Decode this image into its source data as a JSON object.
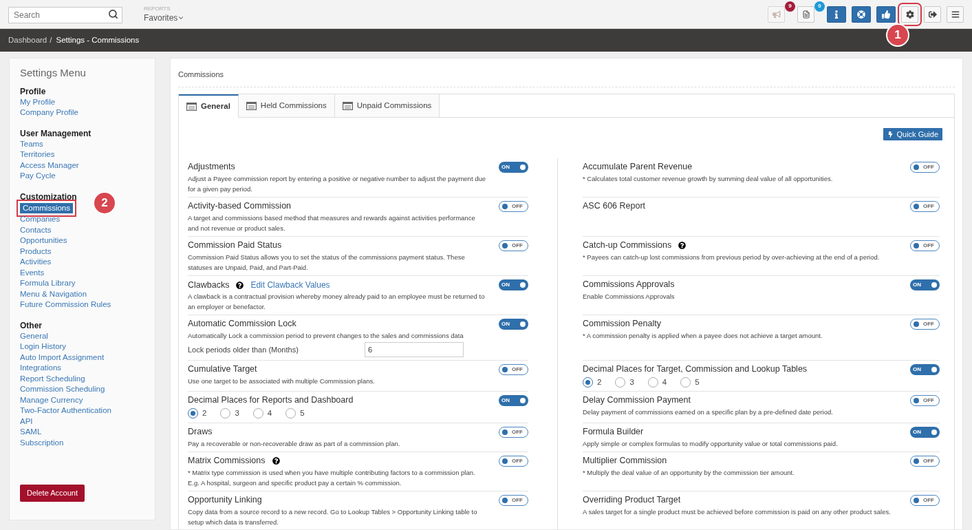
{
  "topbar": {
    "search": {
      "placeholder": "Search"
    },
    "reports": {
      "label": "REPORTS",
      "value": "Favorites"
    },
    "buttons": [
      {
        "kind": "megaphone",
        "badge": "9",
        "color": "#a51d3a"
      },
      {
        "kind": "document",
        "badge": "0",
        "color": "#1e9ad6"
      },
      {
        "kind": "info"
      },
      {
        "kind": "lifebuoy"
      },
      {
        "kind": "thumbsup"
      },
      {
        "kind": "gear",
        "callout": "1"
      },
      {
        "kind": "logout"
      },
      {
        "kind": "menu"
      }
    ]
  },
  "breadcrumb": {
    "items": [
      "Dashboard",
      "Settings - Commissions"
    ],
    "separator": "/"
  },
  "sidebar": {
    "title": "Settings Menu",
    "sections": [
      {
        "heading": "Profile",
        "items": [
          {
            "label": "My Profile",
            "selected": false
          },
          {
            "label": "Company Profile",
            "selected": false
          }
        ]
      },
      {
        "heading": "User Management",
        "items": [
          {
            "label": "Teams",
            "selected": false
          },
          {
            "label": "Territories",
            "selected": false
          },
          {
            "label": "Access Manager",
            "selected": false
          },
          {
            "label": "Pay Cycle",
            "selected": false
          }
        ]
      },
      {
        "heading": "Customization",
        "items": [
          {
            "label": "Commissions",
            "selected": true,
            "callout": "2"
          },
          {
            "label": "Companies",
            "selected": false
          },
          {
            "label": "Contacts",
            "selected": false
          },
          {
            "label": "Opportunities",
            "selected": false
          },
          {
            "label": "Products",
            "selected": false
          },
          {
            "label": "Activities",
            "selected": false
          },
          {
            "label": "Events",
            "selected": false
          },
          {
            "label": "Formula Library",
            "selected": false
          },
          {
            "label": "Menu & Navigation",
            "selected": false
          },
          {
            "label": "Future Commission Rules",
            "selected": false
          }
        ]
      },
      {
        "heading": "Other",
        "items": [
          {
            "label": "General",
            "selected": false
          },
          {
            "label": "Login History",
            "selected": false
          },
          {
            "label": "Auto Import Assignment",
            "selected": false
          },
          {
            "label": "Integrations",
            "selected": false
          },
          {
            "label": "Report Scheduling",
            "selected": false
          },
          {
            "label": "Commission Scheduling",
            "selected": false
          },
          {
            "label": "Manage Currency",
            "selected": false
          },
          {
            "label": "Two-Factor Authentication",
            "selected": false
          },
          {
            "label": "API",
            "selected": false
          },
          {
            "label": "SAML",
            "selected": false
          },
          {
            "label": "Subscription",
            "selected": false
          }
        ]
      }
    ],
    "delete_button": "Delete Account"
  },
  "panel": {
    "title": "Commissions",
    "tabs": [
      {
        "label": "General",
        "selected": true
      },
      {
        "label": "Held Commissions",
        "selected": false
      },
      {
        "label": "Unpaid Commissions",
        "selected": false
      }
    ],
    "quick_guide": "Quick Guide",
    "left_settings": [
      {
        "kind": "toggle",
        "title": "Adjustments",
        "help": false,
        "on": true,
        "toggle_text": "ON",
        "description": "Adjust a Payee commission report by entering a positive or negative number to adjust the payment due for a given pay period."
      },
      {
        "kind": "toggle",
        "title": "Activity-based Commission",
        "help": false,
        "on": false,
        "toggle_text": "OFF",
        "description": "A target and commissions based method that measures and rewards against activities performance and not revenue or product sales."
      },
      {
        "kind": "toggle",
        "title": "Commission Paid Status",
        "help": false,
        "on": false,
        "toggle_text": "OFF",
        "description": "Commission Paid Status allows you to set the status of the commissions payment status. These statuses are Unpaid, Paid, and Part-Paid."
      },
      {
        "kind": "toggle",
        "title": "Clawbacks",
        "help": true,
        "link": "Edit Clawback Values",
        "on": true,
        "toggle_text": "ON",
        "description": "A clawback is a contractual provision whereby money already paid to an employee must be returned to an employer or benefactor."
      },
      {
        "kind": "input",
        "title": "Automatic Commission Lock",
        "help": false,
        "on": true,
        "toggle_text": "ON",
        "description": "Automatically Lock a commission period to prevent changes to the sales and commissions data",
        "field_label": "Lock periods older than (Months)",
        "field_value": "6"
      },
      {
        "kind": "toggle",
        "title": "Cumulative Target",
        "help": false,
        "on": false,
        "toggle_text": "OFF",
        "description": "Use one target to be associated with multiple Commission plans."
      },
      {
        "kind": "radio",
        "title": "Decimal Places for Reports and Dashboard",
        "help": false,
        "on": true,
        "toggle_text": "ON",
        "options": [
          {
            "label": "2",
            "selected": true
          },
          {
            "label": "3",
            "selected": false
          },
          {
            "label": "4",
            "selected": false
          },
          {
            "label": "5",
            "selected": false
          }
        ]
      },
      {
        "kind": "toggle",
        "title": "Draws",
        "help": false,
        "on": false,
        "toggle_text": "OFF",
        "description": "Pay a recoverable or non-recoverable draw as part of a commission plan."
      },
      {
        "kind": "toggle",
        "title": "Matrix Commissions",
        "help": true,
        "on": false,
        "toggle_text": "OFF",
        "description": "* Matrix type commission is used when you have multiple contributing factors to a commission plan. E.g. A hospital, surgeon and specific product pay a certain % commission."
      },
      {
        "kind": "toggle",
        "title": "Opportunity Linking",
        "help": false,
        "on": false,
        "toggle_text": "OFF",
        "description": "Copy data from a source record to a new record. Go to Lookup Tables > Opportunity Linking table to setup which data is transferred."
      }
    ],
    "right_settings": [
      {
        "kind": "toggle",
        "title": "Accumulate Parent Revenue",
        "help": false,
        "on": false,
        "toggle_text": "OFF",
        "description": "* Calculates total customer revenue growth by summing deal value of all opportunities."
      },
      {
        "kind": "toggle",
        "title": "ASC 606 Report",
        "help": false,
        "on": false,
        "toggle_text": "OFF"
      },
      {
        "kind": "toggle",
        "title": "Catch-up Commissions",
        "help": true,
        "on": false,
        "toggle_text": "OFF",
        "description": "* Payees can catch-up lost commissions from previous period by over-achieving at the end of a period."
      },
      {
        "kind": "toggle",
        "title": "Commissions Approvals",
        "help": false,
        "on": true,
        "toggle_text": "ON",
        "description": "Enable Commissions Approvals"
      },
      {
        "kind": "toggle",
        "title": "Commission Penalty",
        "help": false,
        "on": false,
        "toggle_text": "OFF",
        "description": "* A commission penalty is applied when a payee does not achieve a target amount."
      },
      {
        "kind": "radio",
        "title": "Decimal Places for Target, Commission and Lookup Tables",
        "help": false,
        "on": true,
        "toggle_text": "ON",
        "options": [
          {
            "label": "2",
            "selected": true
          },
          {
            "label": "3",
            "selected": false
          },
          {
            "label": "4",
            "selected": false
          },
          {
            "label": "5",
            "selected": false
          }
        ]
      },
      {
        "kind": "toggle",
        "title": "Delay Commission Payment",
        "help": false,
        "on": false,
        "toggle_text": "OFF",
        "description": "Delay payment of commissions earned on a specific plan by a pre-defined date period."
      },
      {
        "kind": "toggle",
        "title": "Formula Builder",
        "help": false,
        "on": true,
        "toggle_text": "ON",
        "description": "Apply simple or complex formulas to modify opportunity value or total commissions paid."
      },
      {
        "kind": "toggle",
        "title": "Multiplier Commission",
        "help": false,
        "on": false,
        "toggle_text": "OFF",
        "description": "* Multiply the deal value of an opportunity by the commission tier amount."
      },
      {
        "kind": "toggle",
        "title": "Overriding Product Target",
        "help": false,
        "on": false,
        "toggle_text": "OFF",
        "description": "A sales target for a single product must be achieved before commission is paid on any other product sales."
      }
    ]
  }
}
